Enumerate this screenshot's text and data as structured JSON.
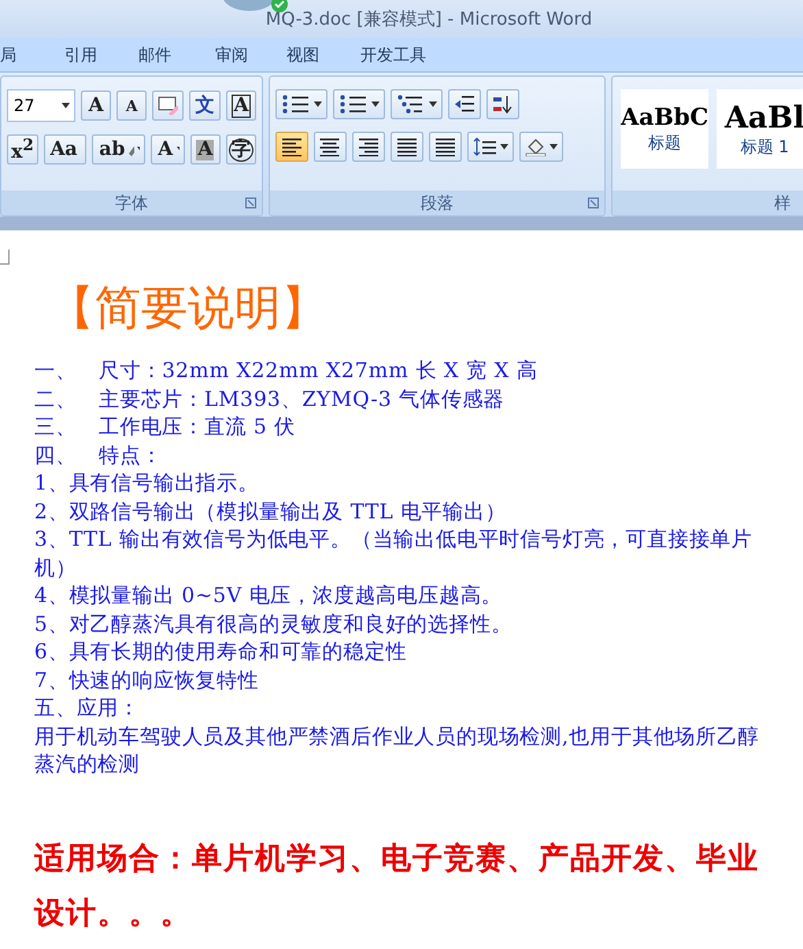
{
  "window": {
    "title": "MQ-3.doc [兼容模式] - Microsoft Word"
  },
  "tabs": [
    {
      "label": "局",
      "selected": false
    },
    {
      "label": "引用",
      "selected": false
    },
    {
      "label": "邮件",
      "selected": false
    },
    {
      "label": "审阅",
      "selected": false
    },
    {
      "label": "视图",
      "selected": false
    },
    {
      "label": "开发工具",
      "selected": false
    }
  ],
  "font_group": {
    "size": "27",
    "label": "字体",
    "row1": [
      {
        "kind": "grow",
        "label": "A"
      },
      {
        "kind": "shrink",
        "label": "A"
      },
      {
        "kind": "clear"
      },
      {
        "kind": "phonetic",
        "label": "文"
      },
      {
        "kind": "border",
        "label": "A"
      }
    ],
    "row2": [
      {
        "kind": "plain",
        "label": "x$^{2}$"
      },
      {
        "kind": "dropdown",
        "label": "Aa"
      },
      {
        "kind": "highlight",
        "label": "ab"
      },
      {
        "kind": "fontcolor",
        "label": "A"
      },
      {
        "kind": "shade",
        "label": "A"
      },
      {
        "kind": "enclose",
        "label": "字"
      }
    ]
  },
  "paragraph_group": {
    "label": "段落",
    "lists": [
      {
        "kind": "bullets"
      },
      {
        "kind": "numbers"
      },
      {
        "kind": "multilevel"
      }
    ],
    "alignment": [
      {
        "kind": "left",
        "selected": true
      },
      {
        "kind": "center",
        "selected": false
      },
      {
        "kind": "right",
        "selected": false
      },
      {
        "kind": "justify",
        "selected": false
      },
      {
        "kind": "distributed",
        "selected": false
      }
    ]
  },
  "styles_group": {
    "label": "样",
    "styles": [
      {
        "preview": "AaBbC",
        "name": "标题"
      },
      {
        "preview": "AaBl",
        "name": "标题 1"
      }
    ]
  },
  "document": {
    "heading": "【简要说明】",
    "items": [
      {
        "marker": "一、",
        "text": "尺寸：32mm X22mm X27mm  长 X 宽 X 高"
      },
      {
        "marker": "二、",
        "text": "主要芯片：LM393、ZYMQ-3 气体传感器"
      },
      {
        "marker": "三、",
        "text": "工作电压：直流 5 伏"
      },
      {
        "marker": "四、",
        "text": "特点："
      }
    ],
    "lines": [
      "1、具有信号输出指示。",
      "2、双路信号输出（模拟量输出及 TTL 电平输出）",
      "3、TTL 输出有效信号为低电平。（当输出低电平时信号灯亮，可直接接单片机）",
      "4、模拟量输出 0~5V 电压，浓度越高电压越高。",
      "5、对乙醇蒸汽具有很高的灵敏度和良好的选择性。",
      "6、具有长期的使用寿命和可靠的稳定性",
      "7、快速的响应恢复特性",
      "五、应用：",
      "用于机动车驾驶人员及其他严禁酒后作业人员的现场检测,也用于其他场所乙醇蒸汽的检测"
    ],
    "footer": "适用场合：单片机学习、电子竞赛、产品开发、毕业设计。。。"
  }
}
